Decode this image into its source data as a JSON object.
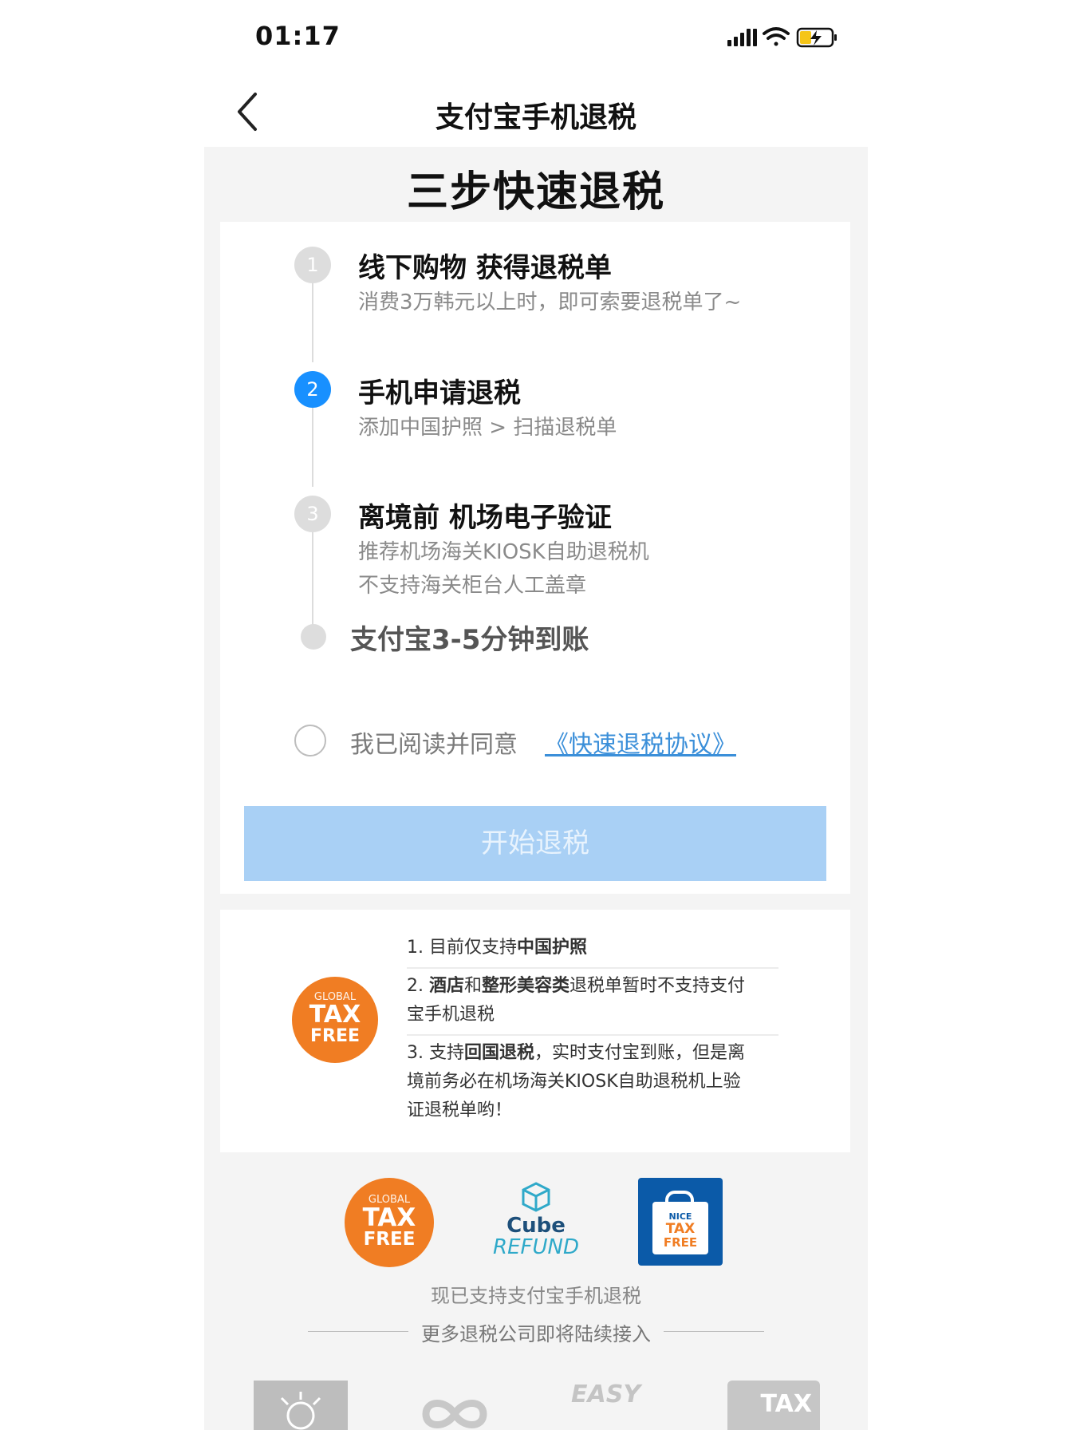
{
  "colors": {
    "accent": "#1890ff",
    "button_disabled": "#a9d0f5",
    "orange": "#f07d23",
    "link": "#3b8fd9"
  },
  "status_bar": {
    "time": "01:17"
  },
  "nav": {
    "title": "支付宝手机退税"
  },
  "hero_title": "三步快速退税",
  "steps": [
    {
      "num": "1",
      "title": "线下购物 获得退税单",
      "desc": [
        "消费3万韩元以上时，即可索要退税单了~"
      ],
      "active": false
    },
    {
      "num": "2",
      "title": "手机申请退税",
      "desc": [
        "添加中国护照 > 扫描退税单"
      ],
      "active": true
    },
    {
      "num": "3",
      "title": "离境前 机场电子验证",
      "desc": [
        "推荐机场海关KIOSK自助退税机",
        "不支持海关柜台人工盖章"
      ],
      "active": false
    }
  ],
  "final_step": "支付宝3-5分钟到账",
  "agreement": {
    "text": "我已阅读并同意",
    "link": "《快速退税协议》"
  },
  "start_button": "开始退税",
  "notes": {
    "n1": {
      "prefix": "1. 目前仅支持",
      "bold": "中国护照"
    },
    "n2": {
      "prefix": "2. ",
      "bold1": "酒店",
      "mid": "和",
      "bold2": "整形美容类",
      "rest1": "退税单暂时不支持支付",
      "rest2": "宝手机退税"
    },
    "n3": {
      "prefix": "3. 支持",
      "bold": "回国退税",
      "rest1": "，实时支付宝到账，但是离",
      "rest2": "境前务必在机场海关KIOSK自助退税机上验",
      "rest3": "证退税单哟！"
    }
  },
  "logos": {
    "global": {
      "line1": "GLOBAL",
      "line2": "TAX",
      "line3": "FREE"
    },
    "cube": {
      "line1": "Cube",
      "line2": "REFUND"
    },
    "nice": {
      "line1": "NICE",
      "line2": "TAX",
      "line3": "FREE"
    },
    "easy": "EASY",
    "tax": "TAX"
  },
  "supported_text": "现已支持支付宝手机退税",
  "more_text": "更多退税公司即将陆续接入"
}
